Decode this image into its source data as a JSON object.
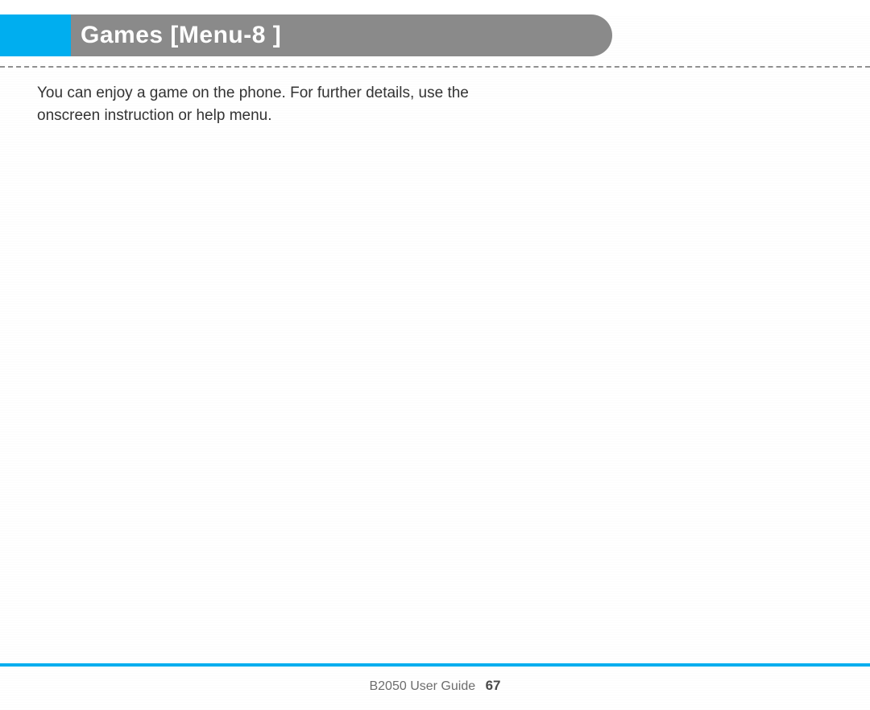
{
  "header": {
    "title": "Games [Menu-8 ]"
  },
  "body": {
    "paragraph": "You can enjoy a game on the phone. For further details, use the onscreen instruction or help menu."
  },
  "footer": {
    "guide_label": "B2050 User Guide",
    "page_number": "67"
  },
  "colors": {
    "accent": "#00aeef",
    "header_gray": "#8a8a8a"
  }
}
